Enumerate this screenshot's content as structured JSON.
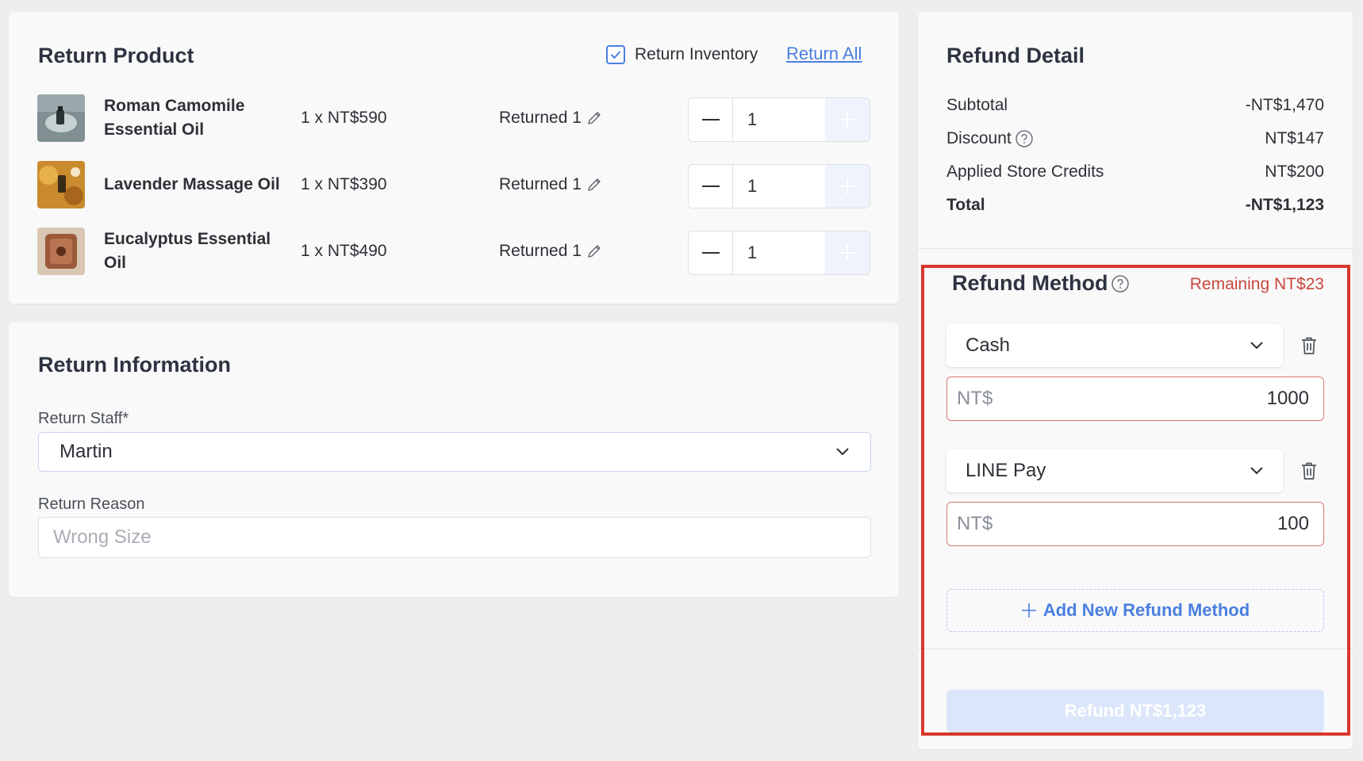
{
  "return_product": {
    "title": "Return Product",
    "return_inventory_label": "Return Inventory",
    "return_inventory_checked": true,
    "return_all_label": "Return All",
    "items": [
      {
        "name": "Roman Camomile Essential Oil",
        "price": "1 x NT$590",
        "returned": "Returned 1",
        "qty": "1",
        "thumb": "thumb-camomile"
      },
      {
        "name": "Lavender Massage Oil",
        "price": "1 x NT$390",
        "returned": "Returned 1",
        "qty": "1",
        "thumb": "thumb-lavender"
      },
      {
        "name": "Eucalyptus Essential Oil",
        "price": "1 x NT$490",
        "returned": "Returned 1",
        "qty": "1",
        "thumb": "thumb-eucalyptus"
      }
    ]
  },
  "return_info": {
    "title": "Return Information",
    "staff_label": "Return Staff*",
    "staff_value": "Martin",
    "reason_label": "Return Reason",
    "reason_placeholder": "Wrong Size"
  },
  "refund_detail": {
    "title": "Refund Detail",
    "rows": [
      {
        "label": "Subtotal",
        "value": "-NT$1,470",
        "help": false
      },
      {
        "label": "Discount",
        "value": "NT$147",
        "help": true
      },
      {
        "label": "Applied Store Credits",
        "value": "NT$200",
        "help": false
      },
      {
        "label": "Total",
        "value": "-NT$1,123",
        "help": false,
        "bold": true
      }
    ]
  },
  "refund_method": {
    "title": "Refund Method",
    "remaining": "Remaining NT$23",
    "methods": [
      {
        "method": "Cash",
        "currency": "NT$",
        "amount": "1000"
      },
      {
        "method": "LINE Pay",
        "currency": "NT$",
        "amount": "100"
      }
    ],
    "add_label": "Add New Refund Method",
    "refund_button": "Refund NT$1,123"
  },
  "colors": {
    "accent": "#4a7fe0",
    "warning": "#c9473a",
    "highlight_frame": "#d9372c"
  }
}
